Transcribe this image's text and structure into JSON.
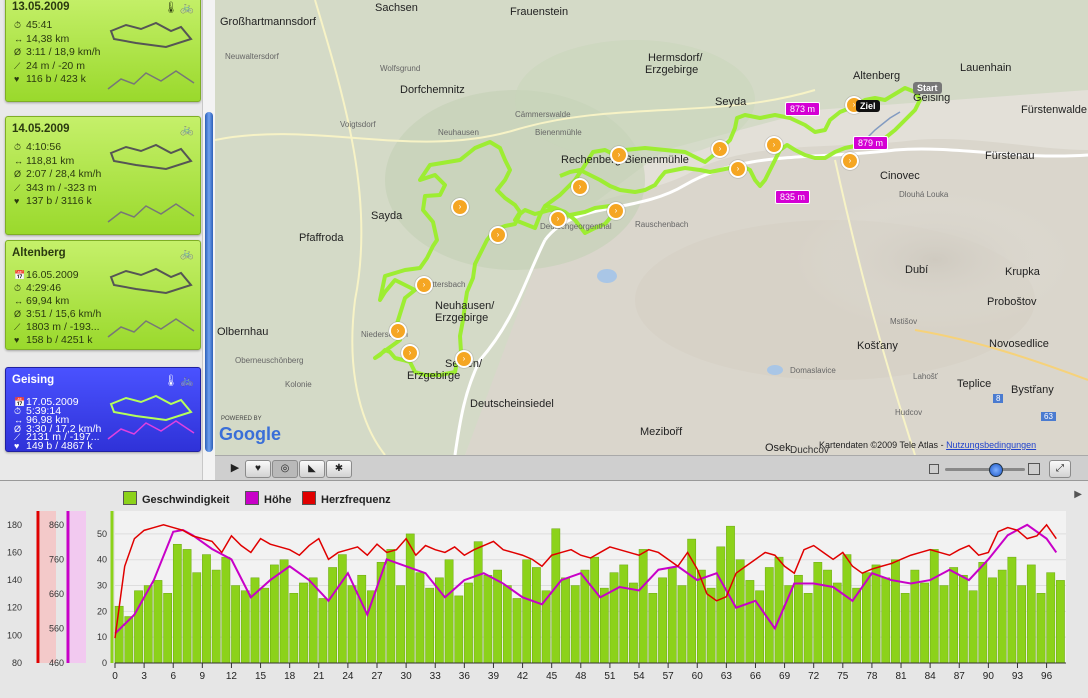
{
  "tours": [
    {
      "title": "13.05.2009",
      "duration": "45:41",
      "distance": "14,38 km",
      "pace": "3:11 / 18,9 km/h",
      "elevation": "24 m / -20 m",
      "heart": "116 b / 423 k",
      "selected": false
    },
    {
      "title": "14.05.2009",
      "duration": "4:10:56",
      "distance": "118,81 km",
      "pace": "2:07 / 28,4 km/h",
      "elevation": "343 m / -323 m",
      "heart": "137 b / 3116 k",
      "selected": false
    },
    {
      "title": "Altenberg",
      "date": "16.05.2009",
      "duration": "4:29:46",
      "distance": "69,94 km",
      "pace": "3:51 / 15,6 km/h",
      "elevation": "1803 m / -193...",
      "heart": "158 b / 4251 k",
      "selected": false
    },
    {
      "title": "Geising",
      "date": "17.05.2009",
      "duration": "5:39:14",
      "distance": "96,98 km",
      "pace": "3:30 / 17,2 km/h",
      "elevation": "2131 m / -197...",
      "heart": "149 b / 4867 k",
      "selected": true
    }
  ],
  "icons": {
    "bike": "bicycle-icon",
    "thermo": "thermometer-icon"
  },
  "map": {
    "places": [
      "Großhartmannsdorf",
      "Sachsen",
      "Frauenstein",
      "Altenberg",
      "Geising",
      "Lauenhain",
      "Fürstenwalde",
      "Fürstenau",
      "Hermsdorf/",
      "Erzgebirge",
      "Dorfchemnitz",
      "Seyda",
      "Rechenberg-Bienenmühle",
      "Cinovec",
      "Sayda",
      "Pfaffroda",
      "Dubí",
      "Krupka",
      "Neuhausen/",
      "Erzgebirge",
      "Olbernhau",
      "Proboštov",
      "Novosedlice",
      "Košťany",
      "Seiffen/",
      "Erzgebirge",
      "Teplice",
      "Bystřany",
      "Osek",
      "Deutscheinsiedel",
      "Mezibořf",
      "Duchcov",
      "Voigtsdorf",
      "Wolfsgrund",
      "Neuwaltersdorf",
      "Oberneuschönberg",
      "Kolonie",
      "Bienenmühle",
      "Neuhausen",
      "Cämmerswalde",
      "Dittersbach",
      "Niederseiffen",
      "Rauschenbach",
      "Deutschgeorgenthal",
      "Dlouhá Louka",
      "Domaslavice",
      "Mstišov",
      "Hudcov",
      "Lahošť"
    ],
    "elevations": [
      "873 m",
      "879 m",
      "835 m"
    ],
    "ziel": "Ziel",
    "start": "Start",
    "attribution": "Kartendaten ©2009 Tele Atlas",
    "terms": "Nutzungsbedingungen",
    "powered": "POWERED BY",
    "google": "Google",
    "road_numbers": [
      "8",
      "63"
    ]
  },
  "legend": {
    "speed": "Geschwindigkeit",
    "height": "Höhe",
    "heart": "Herzfrequenz"
  },
  "colors": {
    "speed": "#8cd21a",
    "height": "#c800c8",
    "heart": "#e00000",
    "route": "#9aee2a",
    "selected": "#3538e6"
  },
  "chart_data": {
    "type": "bar",
    "x_ticks": [
      "0",
      "3",
      "6",
      "9",
      "12",
      "15",
      "18",
      "21",
      "24",
      "27",
      "30",
      "33",
      "36",
      "39",
      "42",
      "45",
      "48",
      "51",
      "54",
      "57",
      "60",
      "63",
      "66",
      "69",
      "72",
      "75",
      "78",
      "81",
      "84",
      "87",
      "90",
      "93",
      "96"
    ],
    "xlim": [
      0,
      98
    ],
    "speed_axis": {
      "ticks": [
        "0",
        "10",
        "20",
        "30",
        "40",
        "50"
      ],
      "ylim": [
        0,
        55
      ]
    },
    "height_axis": {
      "ticks": [
        "460",
        "560",
        "660",
        "760",
        "860"
      ],
      "ylim": [
        460,
        900
      ]
    },
    "heart_axis": {
      "ticks": [
        "80",
        "100",
        "120",
        "140",
        "160",
        "180"
      ],
      "ylim": [
        80,
        190
      ]
    },
    "series": [
      {
        "name": "Geschwindigkeit",
        "kind": "bar",
        "x": [
          0,
          1,
          2,
          3,
          4,
          5,
          6,
          7,
          8,
          9,
          10,
          11,
          12,
          13,
          14,
          15,
          16,
          17,
          18,
          19,
          20,
          21,
          22,
          23,
          24,
          25,
          26,
          27,
          28,
          29,
          30,
          31,
          32,
          33,
          34,
          35,
          36,
          37,
          38,
          39,
          40,
          41,
          42,
          43,
          44,
          45,
          46,
          47,
          48,
          49,
          50,
          51,
          52,
          53,
          54,
          55,
          56,
          57,
          58,
          59,
          60,
          61,
          62,
          63,
          64,
          65,
          66,
          67,
          68,
          69,
          70,
          71,
          72,
          73,
          74,
          75,
          76,
          77,
          78,
          79,
          80,
          81,
          82,
          83,
          84,
          85,
          86,
          87,
          88,
          89,
          90,
          91,
          92,
          93,
          94,
          95,
          96,
          97
        ],
        "values": [
          22,
          18,
          28,
          30,
          32,
          27,
          46,
          44,
          35,
          42,
          36,
          41,
          30,
          28,
          33,
          29,
          38,
          40,
          27,
          31,
          33,
          25,
          37,
          42,
          30,
          34,
          28,
          39,
          44,
          30,
          50,
          35,
          29,
          33,
          40,
          26,
          31,
          47,
          34,
          36,
          30,
          25,
          40,
          37,
          28,
          52,
          33,
          30,
          36,
          41,
          29,
          35,
          38,
          31,
          44,
          27,
          33,
          37,
          30,
          48,
          36,
          29,
          45,
          53,
          40,
          32,
          28,
          37,
          41,
          30,
          34,
          27,
          39,
          36,
          31,
          42,
          29,
          35,
          38,
          33,
          40,
          27,
          36,
          31,
          44,
          30,
          37,
          34,
          28,
          39,
          33,
          36,
          41,
          30,
          38,
          27,
          35,
          32
        ]
      },
      {
        "name": "Höhe",
        "kind": "line",
        "x": [
          0,
          2,
          4,
          6,
          7,
          8,
          10,
          12,
          14,
          16,
          18,
          20,
          22,
          24,
          26,
          28,
          30,
          32,
          34,
          36,
          38,
          40,
          42,
          44,
          46,
          48,
          50,
          52,
          54,
          56,
          58,
          60,
          62,
          64,
          66,
          68,
          70,
          72,
          74,
          76,
          78,
          80,
          82,
          84,
          86,
          88,
          90,
          92,
          94,
          96,
          97
        ],
        "values": [
          545,
          600,
          700,
          840,
          845,
          830,
          790,
          760,
          650,
          700,
          740,
          700,
          640,
          720,
          600,
          760,
          740,
          720,
          650,
          700,
          720,
          690,
          650,
          630,
          700,
          720,
          650,
          680,
          670,
          730,
          740,
          700,
          720,
          620,
          640,
          560,
          690,
          690,
          680,
          640,
          720,
          700,
          690,
          700,
          730,
          700,
          760,
          830,
          860,
          820,
          780
        ]
      },
      {
        "name": "Herzfrequenz",
        "kind": "line",
        "x": [
          0,
          1,
          2,
          3,
          4,
          5,
          6,
          7,
          8,
          9,
          10,
          11,
          12,
          13,
          14,
          15,
          16,
          17,
          18,
          19,
          20,
          21,
          22,
          23,
          24,
          25,
          26,
          27,
          28,
          29,
          30,
          31,
          32,
          33,
          34,
          35,
          36,
          37,
          38,
          39,
          40,
          41,
          42,
          43,
          44,
          45,
          46,
          47,
          48,
          49,
          50,
          51,
          52,
          53,
          54,
          55,
          56,
          57,
          58,
          59,
          60,
          61,
          62,
          63,
          64,
          65,
          66,
          67,
          68,
          69,
          70,
          71,
          72,
          73,
          74,
          75,
          76,
          77,
          78,
          79,
          80,
          81,
          82,
          83,
          84,
          85,
          86,
          87,
          88,
          89,
          90,
          91,
          92,
          93,
          94,
          95,
          96,
          97
        ],
        "values": [
          98,
          150,
          170,
          176,
          178,
          180,
          178,
          176,
          172,
          170,
          168,
          160,
          172,
          165,
          160,
          170,
          166,
          164,
          162,
          158,
          165,
          170,
          155,
          160,
          162,
          164,
          158,
          166,
          160,
          162,
          170,
          158,
          165,
          162,
          160,
          164,
          158,
          162,
          165,
          168,
          162,
          160,
          158,
          155,
          150,
          158,
          160,
          162,
          158,
          156,
          160,
          164,
          162,
          160,
          158,
          162,
          160,
          155,
          150,
          160,
          148,
          130,
          125,
          128,
          145,
          150,
          155,
          160,
          158,
          150,
          145,
          162,
          165,
          160,
          155,
          160,
          150,
          145,
          148,
          150,
          152,
          155,
          158,
          160,
          162,
          160,
          158,
          162,
          165,
          158,
          160,
          175,
          178,
          176,
          170,
          172,
          180,
          170
        ]
      }
    ]
  }
}
